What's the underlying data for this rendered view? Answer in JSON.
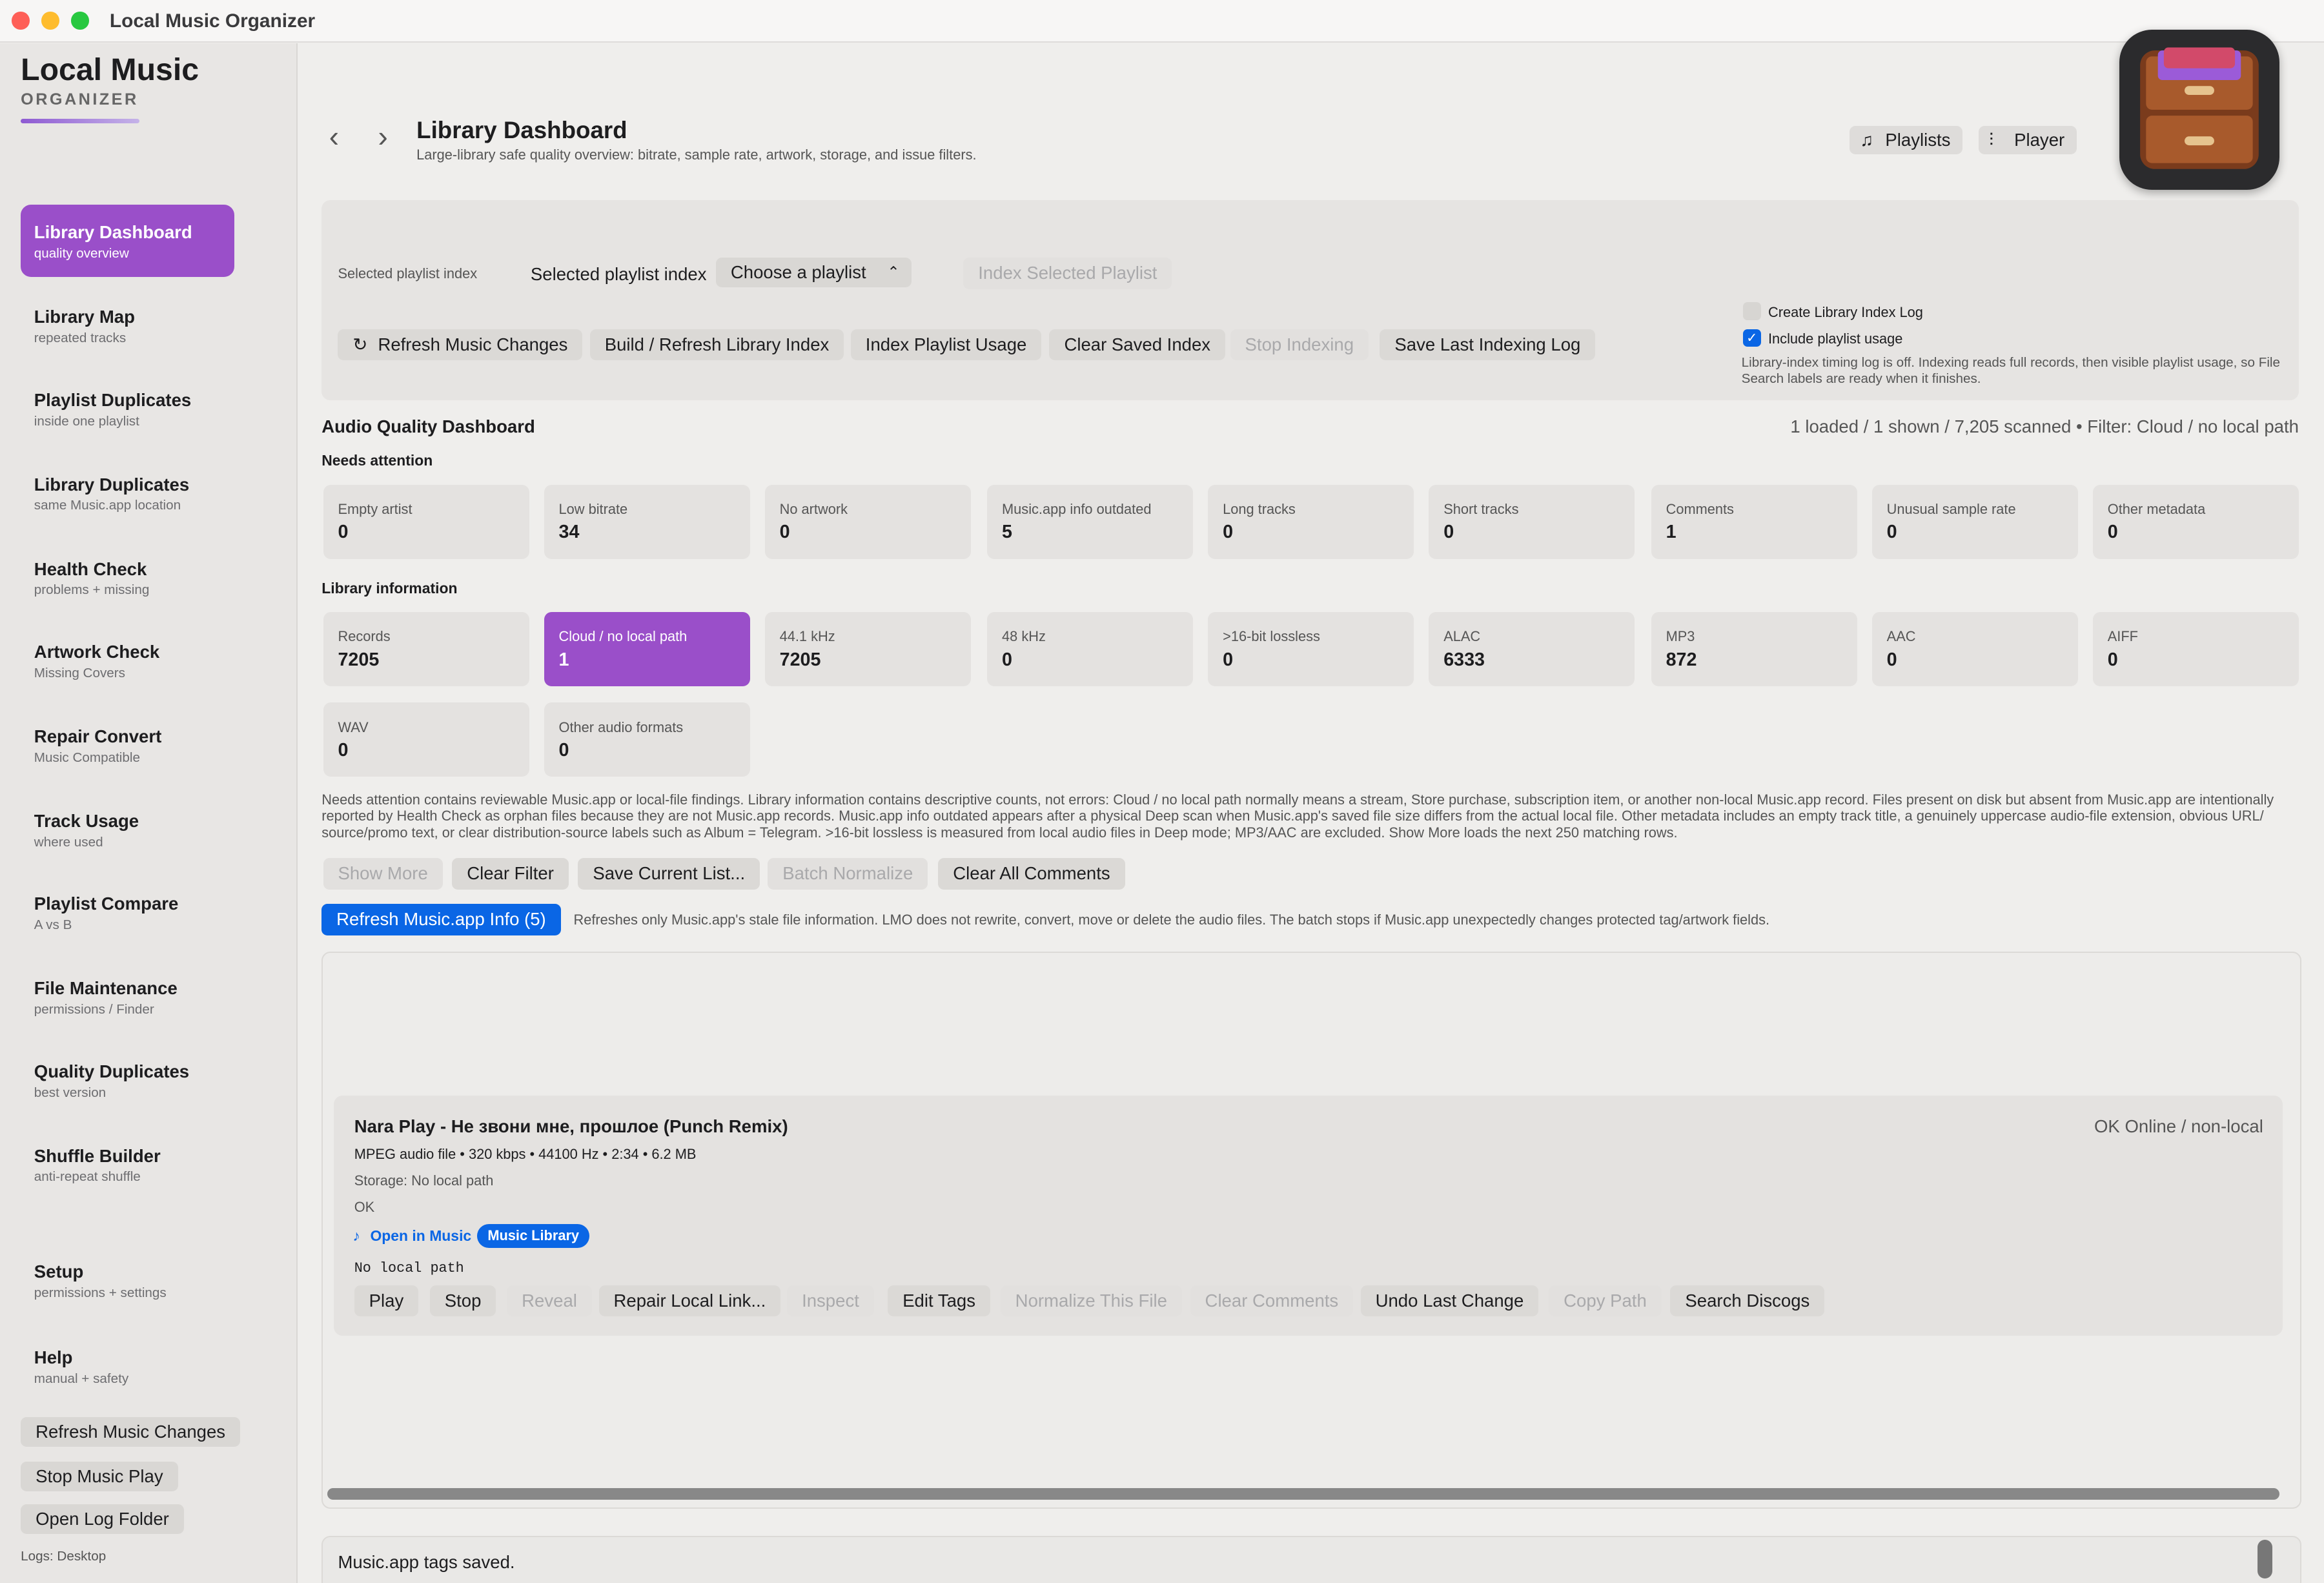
{
  "window": {
    "title": "Local Music Organizer"
  },
  "brand": {
    "title": "Local Music",
    "subtitle": "ORGANIZER"
  },
  "sidebar": {
    "items": [
      {
        "label": "Library Dashboard",
        "sub": "quality overview"
      },
      {
        "label": "Library Map",
        "sub": "repeated tracks"
      },
      {
        "label": "Playlist Duplicates",
        "sub": "inside one playlist"
      },
      {
        "label": "Library Duplicates",
        "sub": "same Music.app location"
      },
      {
        "label": "Health Check",
        "sub": "problems + missing"
      },
      {
        "label": "Artwork Check",
        "sub": "Missing Covers"
      },
      {
        "label": "Repair Convert",
        "sub": "Music Compatible"
      },
      {
        "label": "Track Usage",
        "sub": "where used"
      },
      {
        "label": "Playlist Compare",
        "sub": "A vs B"
      },
      {
        "label": "File Maintenance",
        "sub": "permissions / Finder"
      },
      {
        "label": "Quality Duplicates",
        "sub": "best version"
      },
      {
        "label": "Shuffle Builder",
        "sub": "anti-repeat shuffle"
      },
      {
        "label": "Setup",
        "sub": "permissions + settings"
      },
      {
        "label": "Help",
        "sub": "manual + safety"
      }
    ],
    "buttons": [
      "Refresh Music Changes",
      "Stop Music Play",
      "Open Log Folder"
    ],
    "logs": "Logs: Desktop"
  },
  "header": {
    "title": "Library Dashboard",
    "subtitle": "Large-library safe quality overview: bitrate, sample rate, artwork, storage, and issue filters.",
    "playlists": "Playlists",
    "player": "Player"
  },
  "index_panel": {
    "small_label": "Selected playlist index",
    "label": "Selected playlist index",
    "select_value": "Choose a playlist",
    "index_selected": "Index Selected Playlist",
    "buttons": {
      "refresh": "Refresh Music Changes",
      "build": "Build / Refresh Library Index",
      "usage": "Index Playlist Usage",
      "clear": "Clear Saved Index",
      "stop": "Stop Indexing",
      "save_log": "Save Last Indexing Log"
    },
    "create_log": "Create Library Index Log",
    "include_usage": "Include playlist usage",
    "note": "Library-index timing log is off. Indexing reads full records, then visible playlist usage, so File Search labels are ready when it finishes."
  },
  "dashboard": {
    "title": "Audio Quality Dashboard",
    "status": "1 loaded / 1 shown / 7,205 scanned • Filter: Cloud / no local path",
    "needs_attention": "Needs attention",
    "attention_cards": [
      {
        "label": "Empty artist",
        "value": "0"
      },
      {
        "label": "Low bitrate",
        "value": "34"
      },
      {
        "label": "No artwork",
        "value": "0"
      },
      {
        "label": "Music.app info outdated",
        "value": "5"
      },
      {
        "label": "Long tracks",
        "value": "0"
      },
      {
        "label": "Short tracks",
        "value": "0"
      },
      {
        "label": "Comments",
        "value": "1"
      },
      {
        "label": "Unusual sample rate",
        "value": "0"
      },
      {
        "label": "Other metadata",
        "value": "0"
      }
    ],
    "library_info": "Library information",
    "info_cards": [
      {
        "label": "Records",
        "value": "7205"
      },
      {
        "label": "Cloud / no local path",
        "value": "1"
      },
      {
        "label": "44.1 kHz",
        "value": "7205"
      },
      {
        "label": "48 kHz",
        "value": "0"
      },
      {
        "label": ">16-bit lossless",
        "value": "0"
      },
      {
        "label": "ALAC",
        "value": "6333"
      },
      {
        "label": "MP3",
        "value": "872"
      },
      {
        "label": "AAC",
        "value": "0"
      },
      {
        "label": "AIFF",
        "value": "0"
      },
      {
        "label": "WAV",
        "value": "0"
      },
      {
        "label": "Other audio formats",
        "value": "0"
      }
    ],
    "explanation": "Needs attention contains reviewable Music.app or local-file findings. Library information contains descriptive counts, not errors: Cloud / no local path normally means a stream, Store purchase, subscription item, or another non-local Music.app record. Files present on disk but absent from Music.app are intentionally reported by Health Check as orphan files because they are not Music.app records. Music.app info outdated appears after a physical Deep scan when Music.app's saved file size differs from the actual local file. Other metadata includes an empty track title, a genuinely uppercase audio-file extension, obvious URL/ source/promo text, or clear distribution-source labels such as Album = Telegram. >16-bit lossless is measured from local audio files in Deep mode; MP3/AAC are excluded. Show More loads the next 250 matching rows.",
    "actions": {
      "show_more": "Show More",
      "clear_filter": "Clear Filter",
      "save_list": "Save Current List...",
      "batch_normalize": "Batch Normalize",
      "clear_comments": "Clear All Comments"
    },
    "refresh_info": "Refresh Music.app Info (5)",
    "refresh_note": "Refreshes only Music.app's stale file information. LMO does not rewrite, convert, move or delete the audio files. The batch stops if Music.app unexpectedly changes protected tag/artwork fields."
  },
  "track": {
    "title": "Nara Play - Не звони мне, прошлое (Punch Remix)",
    "meta": "MPEG audio file • 320 kbps • 44100 Hz • 2:34 • 6.2 MB",
    "storage": "Storage: No local path",
    "ok": "OK",
    "open_in_music": "Open in Music",
    "badge": "Music Library",
    "path": "No local path",
    "status": "OK   Online / non-local",
    "buttons": {
      "play": "Play",
      "stop": "Stop",
      "reveal": "Reveal",
      "repair": "Repair Local Link...",
      "inspect": "Inspect",
      "edit_tags": "Edit Tags",
      "normalize": "Normalize This File",
      "clear_comments": "Clear Comments",
      "undo": "Undo Last Change",
      "copy_path": "Copy Path",
      "discogs": "Search Discogs"
    }
  },
  "footer": {
    "message": "Music.app tags saved."
  },
  "colors": {
    "accent_purple": "#9a4fc9",
    "accent_blue": "#0a66e5"
  }
}
